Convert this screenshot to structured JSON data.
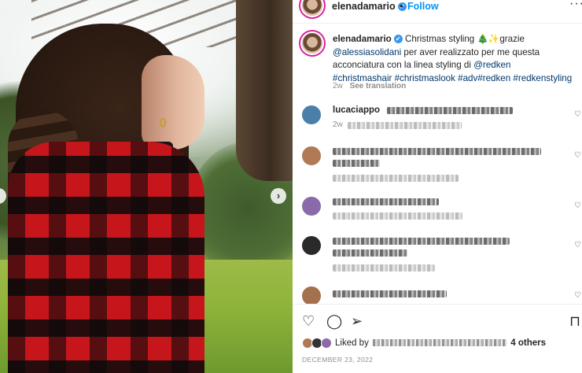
{
  "post": {
    "username": "elenadamario",
    "follow_label": "Follow",
    "dot": "•",
    "more": "···",
    "verified_glyph": "✔",
    "caption": {
      "username": "elenadamario",
      "text_1": "Christmas styling 🎄✨grazie",
      "mention_1": "@alessiasolidani",
      "text_2": "per aver realizzato per me questa acconciatura con la linea styling di",
      "mention_2": "@redken",
      "hashtags": "#christmashair #christmaslook #adv#redken #redkenstyling",
      "age": "2w",
      "see_translation": "See translation"
    }
  },
  "comments": [
    {
      "user": "lucaciappo",
      "time": "2w",
      "avatar_color": "#4a7fa8"
    },
    {
      "user": "",
      "time": "",
      "avatar_color": "#b07a55"
    },
    {
      "user": "",
      "time": "",
      "avatar_color": "#8a6aa8"
    },
    {
      "user": "",
      "time": "",
      "avatar_color": "#2a2a2a"
    },
    {
      "user": "",
      "time": "",
      "avatar_color": "#a5704e"
    }
  ],
  "actions": {
    "like_icon": "heart-icon",
    "comment_icon": "comment-icon",
    "share_icon": "share-icon",
    "save_icon": "bookmark-icon",
    "liked_by_prefix": "Liked by",
    "others_suffix": "4 others",
    "date": "DECEMBER 23, 2022"
  },
  "nav": {
    "next": "›",
    "prev": "‹"
  },
  "colors": {
    "accent": "#0095f6",
    "verified": "#3897f0",
    "link": "#00376b"
  }
}
